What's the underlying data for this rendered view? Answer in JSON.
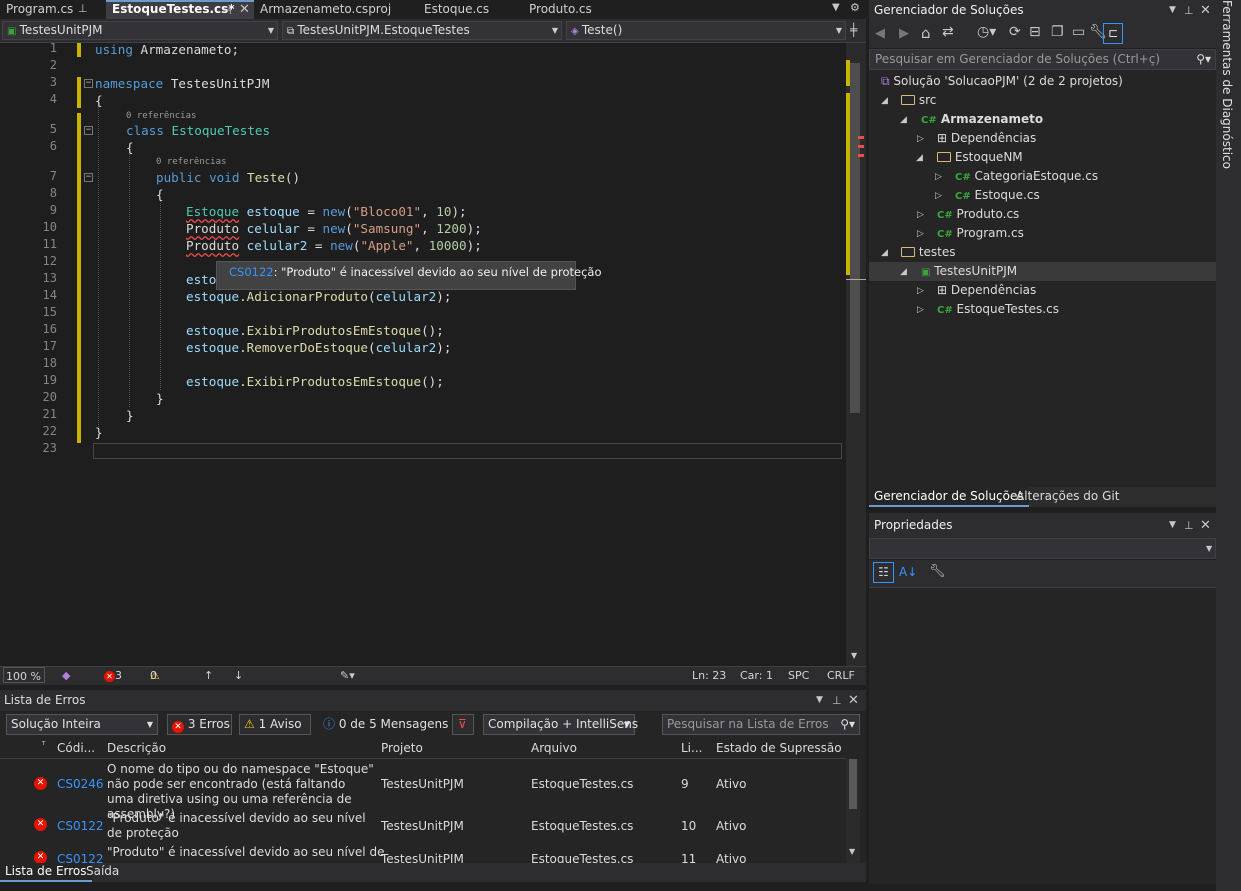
{
  "tabs": [
    {
      "label": "Program.cs"
    },
    {
      "label": "EstoqueTestes.cs*"
    },
    {
      "label": "Armazenameto.csproj"
    },
    {
      "label": "Estoque.cs"
    },
    {
      "label": "Produto.cs"
    }
  ],
  "nav": {
    "project": "TestesUnitPJM",
    "class": "TestesUnitPJM.EstoqueTestes",
    "member": "Teste()"
  },
  "editor": {
    "line_numbers": [
      "1",
      "2",
      "3",
      "4",
      "5",
      "6",
      "7",
      "8",
      "9",
      "10",
      "11",
      "12",
      "13",
      "14",
      "15",
      "16",
      "17",
      "18",
      "19",
      "20",
      "21",
      "22",
      "23"
    ],
    "lens": [
      "0 referências",
      "0 referências"
    ],
    "code": {
      "l1_kw": "using",
      "l1_ns": "Armazenameto;",
      "l3_kw": "namespace",
      "l3_ns": "TestesUnitPJM",
      "brace_open": "{",
      "brace_close": "}",
      "l5_kw": "class",
      "l5_ty": "EstoqueTestes",
      "l7_kw": "public void",
      "l7_fn": "Teste",
      "l9": {
        "type": "Estoque",
        "var": "estoque",
        "eq": " = ",
        "new": "new",
        "open": "(",
        "str": "\"Bloco01\"",
        "comma": ", ",
        "num": "10",
        "close": ");"
      },
      "l10": {
        "type": "Produto",
        "var": "celular",
        "eq": " = ",
        "new": "new",
        "open": "(",
        "str": "\"Samsung\"",
        "comma": ", ",
        "num": "1200",
        "close": ");"
      },
      "l11": {
        "type": "Produto",
        "var": "celular2",
        "eq": " = ",
        "new": "new",
        "open": "(",
        "str": "\"Apple\"",
        "comma": ", ",
        "num": "10000",
        "close": ");"
      },
      "l13_var": "esto",
      "l14": {
        "var": "estoque",
        "dot": ".",
        "fn": "AdicionarProduto",
        "arg": "celular2",
        "end": ");"
      },
      "l16": {
        "var": "estoque",
        "dot": ".",
        "fn": "ExibirProdutosEmEstoque",
        "end": "();"
      },
      "l17": {
        "var": "estoque",
        "dot": ".",
        "fn": "RemoverDoEstoque",
        "arg": "celular2",
        "end": ");"
      },
      "l19": {
        "var": "estoque",
        "dot": ".",
        "fn": "ExibirProdutosEmEstoque",
        "end": "();"
      }
    },
    "tooltip": {
      "code": "CS0122",
      "message": ": \"Produto\" é inacessível devido ao seu nível de proteção"
    }
  },
  "editor_status": {
    "zoom": "100 %",
    "errors": "3",
    "warnings": "0",
    "line": "Ln: 23",
    "col": "Car: 1",
    "spc": "SPC",
    "eol": "CRLF"
  },
  "error_list": {
    "title": "Lista de Erros",
    "scope": "Solução Inteira",
    "errors_btn": "3 Erros",
    "warn_btn": "1 Aviso",
    "msg_btn": "0 de 5 Mensagens",
    "build": "Compilação + IntelliSens",
    "search_placeholder": "Pesquisar na Lista de Erros",
    "columns": [
      "Códi...",
      "Descrição",
      "Projeto",
      "Arquivo",
      "Li...",
      "Estado de Supressão"
    ],
    "rows": [
      {
        "code": "CS0246",
        "desc": "O nome do tipo ou do namespace \"Estoque\" não pode ser encontrado (está faltando uma diretiva using ou uma referência de assembly?)",
        "project": "TestesUnitPJM",
        "file": "EstoqueTestes.cs",
        "line": "9",
        "state": "Ativo"
      },
      {
        "code": "CS0122",
        "desc": "\"Produto\" é inacessível devido ao seu nível de proteção",
        "project": "TestesUnitPJM",
        "file": "EstoqueTestes.cs",
        "line": "10",
        "state": "Ativo"
      },
      {
        "code": "CS0122",
        "desc": "\"Produto\" é inacessível devido ao seu nível de",
        "project": "TestesUnitPJM",
        "file": "EstoqueTestes.cs",
        "line": "11",
        "state": "Ativo"
      }
    ]
  },
  "bottom_tabs": [
    "Lista de Erros",
    "Saída"
  ],
  "solution": {
    "title": "Gerenciador de Soluções",
    "search_placeholder": "Pesquisar em Gerenciador de Soluções (Ctrl+ç)",
    "items": [
      "Solução 'SolucaoPJM' (2 de 2 projetos)",
      "src",
      "Armazenameto",
      "Dependências",
      "EstoqueNM",
      "CategoriaEstoque.cs",
      "Estoque.cs",
      "Produto.cs",
      "Program.cs",
      "testes",
      "TestesUnitPJM",
      "Dependências",
      "EstoqueTestes.cs"
    ],
    "tabs": [
      "Gerenciador de Soluções",
      "Alterações do Git"
    ]
  },
  "properties": {
    "title": "Propriedades"
  },
  "diagnostic": {
    "label": "Ferramentas de Diagnóstico"
  },
  "colors": {
    "accent": "#6b9bd1",
    "error": "#e51400",
    "keyword": "#569cd6",
    "type": "#4ec9b0"
  }
}
